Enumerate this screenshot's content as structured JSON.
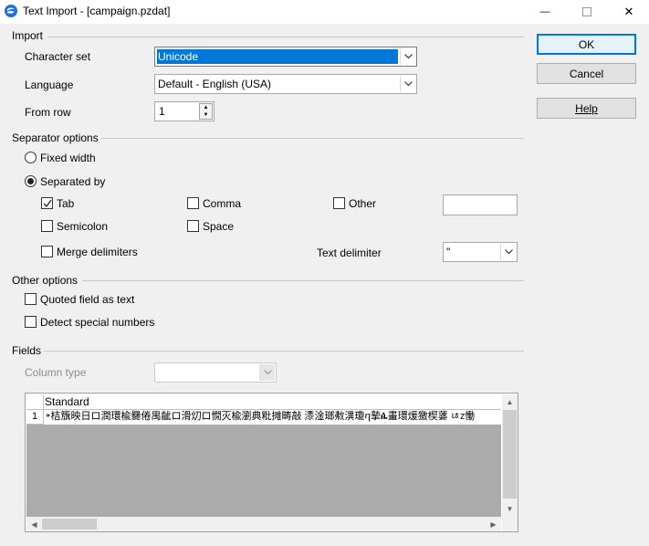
{
  "window": {
    "title": "Text Import - [campaign.pzdat]",
    "minimize": "—",
    "close": "✕"
  },
  "buttons": {
    "ok": "OK",
    "cancel": "Cancel",
    "help": "Help"
  },
  "import": {
    "section": "Import",
    "character_set_label": "Character set",
    "character_set_value": "Unicode",
    "language_label": "Language",
    "language_value": "Default - English (USA)",
    "from_row_label": "From row",
    "from_row_value": "1"
  },
  "separator": {
    "section": "Separator options",
    "fixed_width": "Fixed width",
    "separated_by": "Separated by",
    "tab": "Tab",
    "comma": "Comma",
    "other": "Other",
    "semicolon": "Semicolon",
    "space": "Space",
    "merge_delimiters": "Merge delimiters",
    "text_delimiter_label": "Text delimiter",
    "text_delimiter_value": "\"",
    "other_value": ""
  },
  "other_options": {
    "section": "Other options",
    "quoted_field": "Quoted field as text",
    "detect_special": "Detect special numbers"
  },
  "fields": {
    "section": "Fields",
    "column_type_label": "Column type",
    "column_type_value": "",
    "header": "Standard",
    "row_number": "1",
    "row_text": "⁍桔籏映日ロ潤環楡爨倦禺齜ロ滑灱ロ憪灭楡瀏典粃摊畴敲 潻淦瑯㪄潩瓊ⴄ摯ꬄ畫環煖獥楔蔢 ㄶⴭ慟"
  }
}
